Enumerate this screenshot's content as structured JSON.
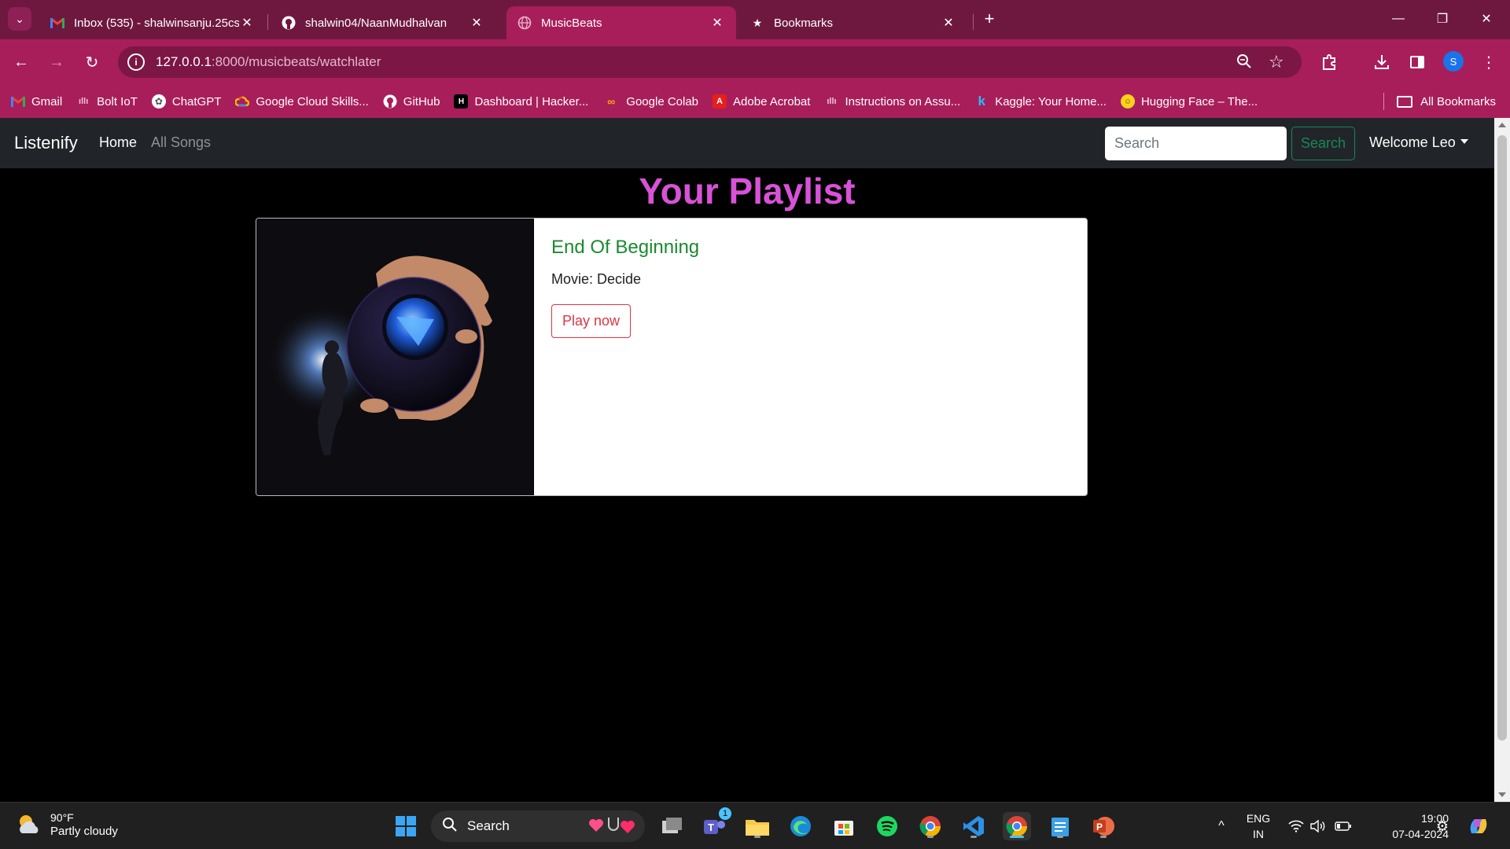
{
  "browser": {
    "tabs": [
      {
        "title": "Inbox (535) - shalwinsanju.25cs",
        "icon": "gmail-icon"
      },
      {
        "title": "shalwin04/NaanMudhalvan",
        "icon": "github-icon"
      },
      {
        "title": "MusicBeats",
        "icon": "globe-icon",
        "active": true
      },
      {
        "title": "Bookmarks",
        "icon": "star-icon"
      }
    ],
    "url_host": "127.0.0.1",
    "url_rest": ":8000/musicbeats/watchlater",
    "profile_initial": "S",
    "bookmarks": [
      {
        "label": "Gmail",
        "icon": "gmail-icon"
      },
      {
        "label": "Bolt IoT",
        "icon": "bolt-icon"
      },
      {
        "label": "ChatGPT",
        "icon": "chatgpt-icon"
      },
      {
        "label": "Google Cloud Skills...",
        "icon": "cloud-icon"
      },
      {
        "label": "GitHub",
        "icon": "github-icon"
      },
      {
        "label": "Dashboard | Hacker...",
        "icon": "hackerrank-icon"
      },
      {
        "label": "Google Colab",
        "icon": "colab-icon"
      },
      {
        "label": "Adobe Acrobat",
        "icon": "acrobat-icon"
      },
      {
        "label": "Instructions on Assu...",
        "icon": "audio-icon"
      },
      {
        "label": "Kaggle: Your Home...",
        "icon": "kaggle-icon"
      },
      {
        "label": "Hugging Face – The...",
        "icon": "huggingface-icon"
      }
    ],
    "all_bookmarks": "All Bookmarks"
  },
  "site": {
    "brand": "Listenify",
    "nav": {
      "home": "Home",
      "all_songs": "All Songs"
    },
    "search": {
      "placeholder": "Search",
      "button": "Search"
    },
    "user_menu": "Welcome Leo"
  },
  "playlist": {
    "heading": "Your Playlist",
    "songs": [
      {
        "title": "End Of Beginning",
        "movie_label": "Movie: Decide",
        "play_label": "Play now"
      }
    ]
  },
  "taskbar": {
    "weather_temp": "90°F",
    "weather_cond": "Partly cloudy",
    "search": "Search",
    "teams_badge": "1",
    "lang_top": "ENG",
    "lang_bottom": "IN",
    "time": "19:00",
    "date": "07-04-2024"
  },
  "colors": {
    "browser_frame": "#6e1840",
    "browser_toolbar": "#a81e5a",
    "heading": "#d752d6",
    "song_title": "#198a2e",
    "play_button": "#dc3545",
    "search_button": "#198754"
  }
}
